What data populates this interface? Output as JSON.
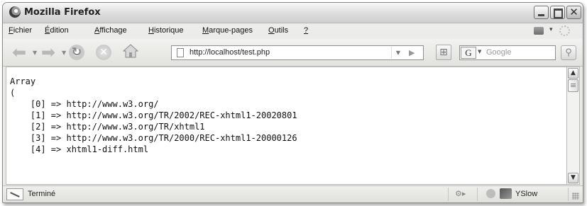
{
  "window": {
    "title": "Mozilla Firefox"
  },
  "menu": {
    "items": [
      {
        "label": "Fichier",
        "name": "menu-fichier"
      },
      {
        "label": "Édition",
        "name": "menu-edition"
      },
      {
        "label": "Affichage",
        "name": "menu-affichage"
      },
      {
        "label": "Historique",
        "name": "menu-historique"
      },
      {
        "label": "Marque-pages",
        "name": "menu-marque-pages"
      },
      {
        "label": "Outils",
        "name": "menu-outils"
      },
      {
        "label": "?",
        "name": "menu-help"
      }
    ]
  },
  "toolbar": {
    "url": "http://localhost/test.php",
    "search_placeholder": "Google",
    "search_engine_letter": "G"
  },
  "content": {
    "lines": [
      "Array",
      "(",
      "    [0] => http://www.w3.org/",
      "    [1] => http://www.w3.org/TR/2002/REC-xhtml1-20020801",
      "    [2] => http://www.w3.org/TR/xhtml1",
      "    [3] => http://www.w3.org/TR/2000/REC-xhtml1-20000126",
      "    [4] => xhtml1-diff.html"
    ]
  },
  "status": {
    "text": "Terminé",
    "yslow_label": "YSlow"
  },
  "icons": {
    "back": "back-arrow-icon",
    "forward": "forward-arrow-icon",
    "reload": "reload-icon",
    "stop": "stop-icon",
    "home": "home-icon",
    "go": "go-icon",
    "search": "magnifier-icon"
  }
}
